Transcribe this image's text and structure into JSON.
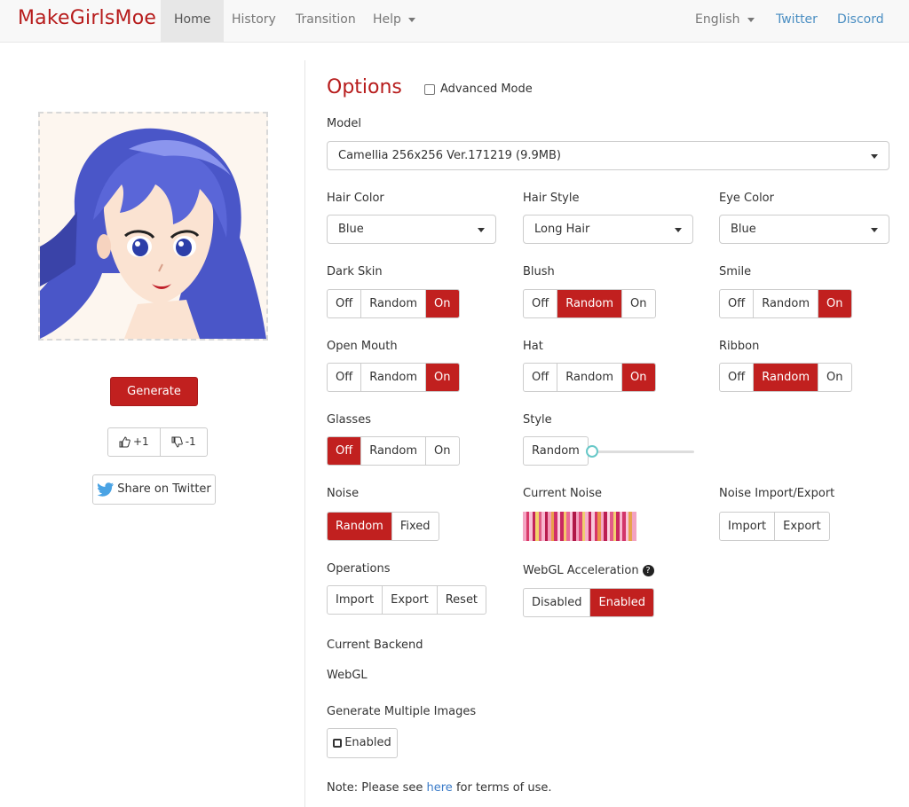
{
  "brand": "MakeGirlsMoe",
  "nav": {
    "home": "Home",
    "history": "History",
    "transition": "Transition",
    "help": "Help",
    "language": "English",
    "twitter": "Twitter",
    "discord": "Discord"
  },
  "left": {
    "generate_label": "Generate",
    "upvote_label": "+1",
    "downvote_label": "-1",
    "share_label": "Share on Twitter"
  },
  "options": {
    "title": "Options",
    "advanced_mode_label": "Advanced Mode",
    "model_label": "Model",
    "model_value": "Camellia 256x256 Ver.171219 (9.9MB)",
    "hair_color_label": "Hair Color",
    "hair_color_value": "Blue",
    "hair_style_label": "Hair Style",
    "hair_style_value": "Long Hair",
    "eye_color_label": "Eye Color",
    "eye_color_value": "Blue",
    "dark_skin_label": "Dark Skin",
    "blush_label": "Blush",
    "smile_label": "Smile",
    "open_mouth_label": "Open Mouth",
    "hat_label": "Hat",
    "ribbon_label": "Ribbon",
    "glasses_label": "Glasses",
    "style_label": "Style",
    "toggle_off": "Off",
    "toggle_random": "Random",
    "toggle_on": "On",
    "style_random": "Random",
    "noise_label": "Noise",
    "noise_random": "Random",
    "noise_fixed": "Fixed",
    "current_noise_label": "Current Noise",
    "noise_io_label": "Noise Import/Export",
    "import_label": "Import",
    "export_label": "Export",
    "reset_label": "Reset",
    "operations_label": "Operations",
    "webgl_label": "WebGL Acceleration",
    "webgl_disabled": "Disabled",
    "webgl_enabled": "Enabled",
    "current_backend_label": "Current Backend",
    "current_backend_value": "WebGL",
    "multiple_images_label": "Generate Multiple Images",
    "multiple_images_value": "Enabled",
    "note_prefix": "Note: Please see ",
    "note_link": "here",
    "note_suffix": " for terms of use."
  },
  "colors": {
    "accent": "#c1201f",
    "brand": "#b71c1c",
    "link": "#3a7bc8"
  }
}
